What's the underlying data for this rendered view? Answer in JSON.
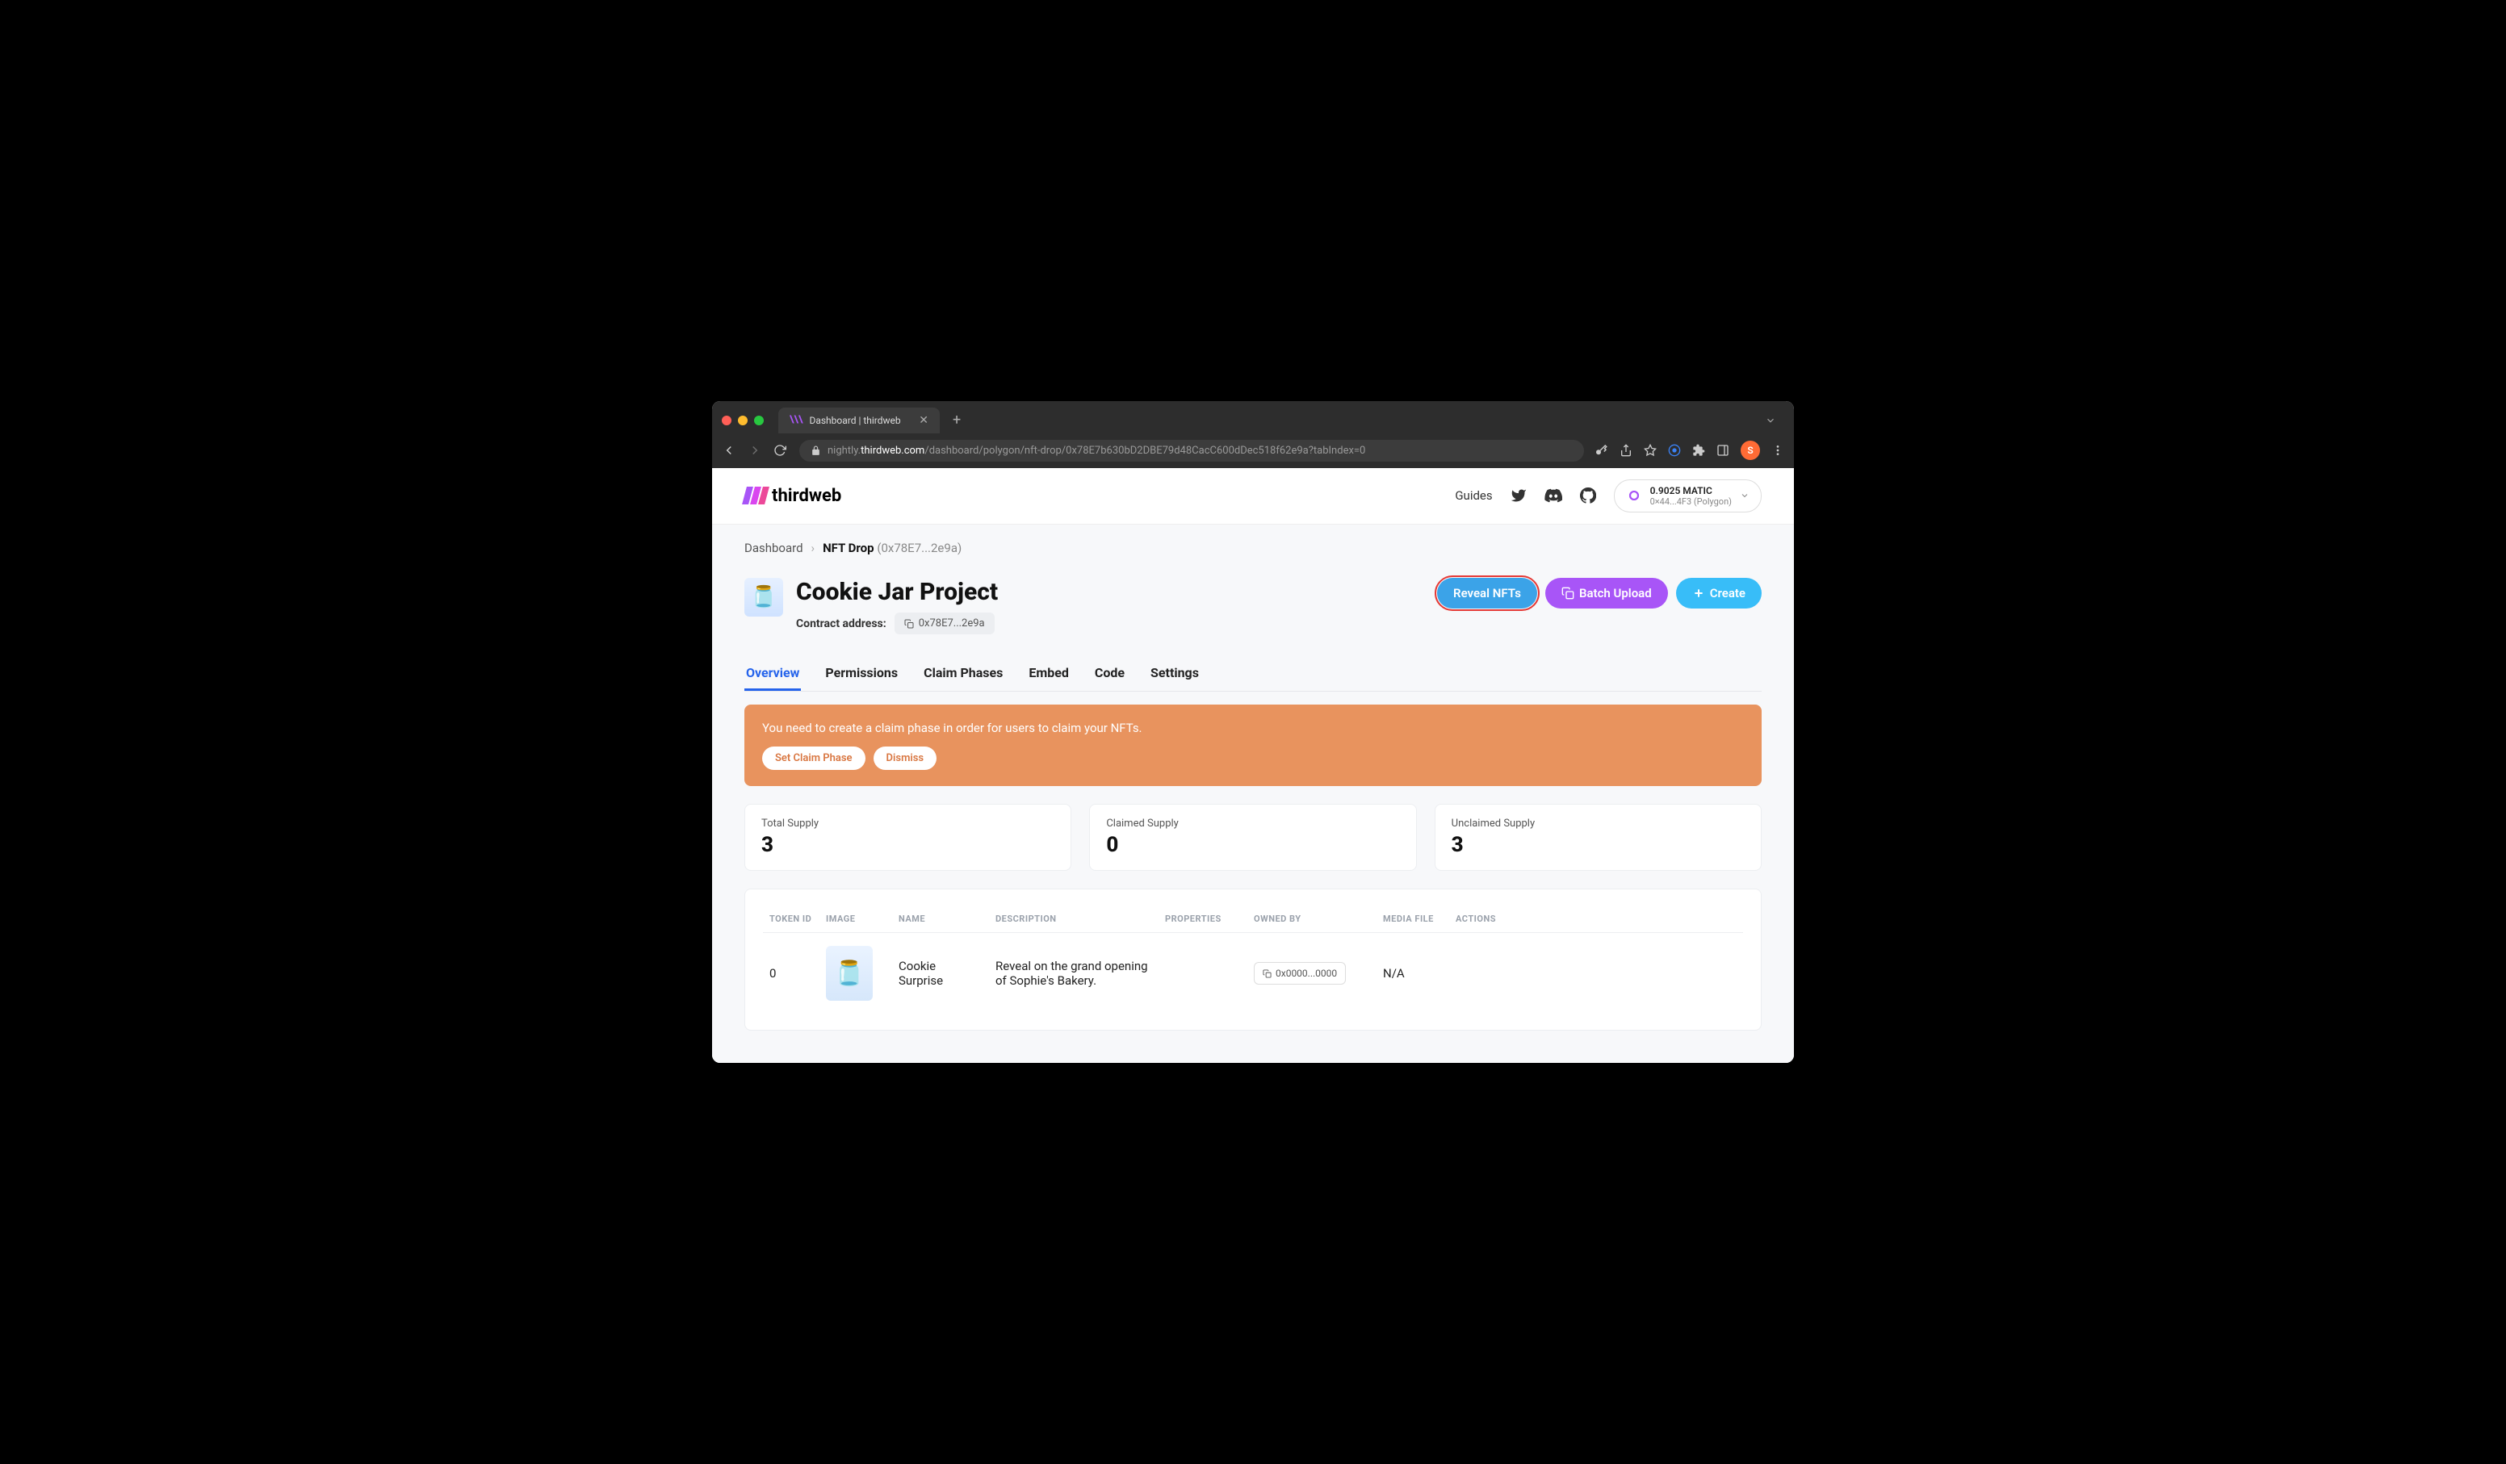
{
  "browser": {
    "tab_title": "Dashboard | thirdweb",
    "url_prefix": "nightly.",
    "url_domain": "thirdweb.com",
    "url_path": "/dashboard/polygon/nft-drop/0x78E7b630bD2DBE79d48CacC600dDec518f62e9a?tabIndex=0",
    "avatar_letter": "S"
  },
  "header": {
    "brand": "thirdweb",
    "guides": "Guides",
    "wallet_balance": "0.9025 MATIC",
    "wallet_address": "0×44...4F3 (Polygon)"
  },
  "breadcrumb": {
    "root": "Dashboard",
    "current": "NFT Drop",
    "hash": "(0x78E7...2e9a)"
  },
  "project": {
    "title": "Cookie Jar Project",
    "contract_label": "Contract address:",
    "contract_address": "0x78E7...2e9a"
  },
  "actions": {
    "reveal": "Reveal NFTs",
    "batch": "Batch Upload",
    "create": "Create"
  },
  "tabs": [
    "Overview",
    "Permissions",
    "Claim Phases",
    "Embed",
    "Code",
    "Settings"
  ],
  "alert": {
    "message": "You need to create a claim phase in order for users to claim your NFTs.",
    "set_phase": "Set Claim Phase",
    "dismiss": "Dismiss"
  },
  "stats": [
    {
      "label": "Total Supply",
      "value": "3"
    },
    {
      "label": "Claimed Supply",
      "value": "0"
    },
    {
      "label": "Unclaimed Supply",
      "value": "3"
    }
  ],
  "table": {
    "headers": [
      "TOKEN ID",
      "IMAGE",
      "NAME",
      "DESCRIPTION",
      "PROPERTIES",
      "OWNED BY",
      "MEDIA FILE",
      "ACTIONS"
    ],
    "rows": [
      {
        "token_id": "0",
        "name": "Cookie Surprise",
        "description": "Reveal on the grand opening of Sophie's Bakery.",
        "properties": "",
        "owned_by": "0x0000...0000",
        "media_file": "N/A"
      }
    ]
  }
}
